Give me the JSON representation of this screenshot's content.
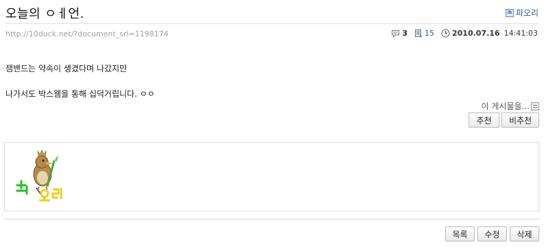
{
  "post": {
    "title": "오늘의 ㅇㅔ언.",
    "author": "파오리",
    "author_icon": "user-badge-icon",
    "document_url": "http://10duck.net/?document_srl=1198174",
    "comment_count": "3",
    "read_count": "15",
    "date": "2010.07.16",
    "time": "14:41:03",
    "body_lines": [
      "잼밴드는 약속이 생겼다며 나갔지만",
      "나가서도 박스웸을 통해 십덕거립니다. ㅇㅇ"
    ]
  },
  "vote": {
    "report_label": "이 게시물을...",
    "recommend_label": "추천",
    "not_recommend_label": "비추천"
  },
  "signature": {
    "image_text": "파오리",
    "image_desc": "farfetchd-signature-image"
  },
  "actions": {
    "list_label": "목록",
    "edit_label": "수정",
    "delete_label": "삭제"
  },
  "icons": {
    "comment": "comment-bubble-icon",
    "read": "document-read-icon",
    "clock": "clock-icon"
  },
  "colors": {
    "link_blue": "#2a55a6",
    "url_gray": "#a0a0a0"
  }
}
